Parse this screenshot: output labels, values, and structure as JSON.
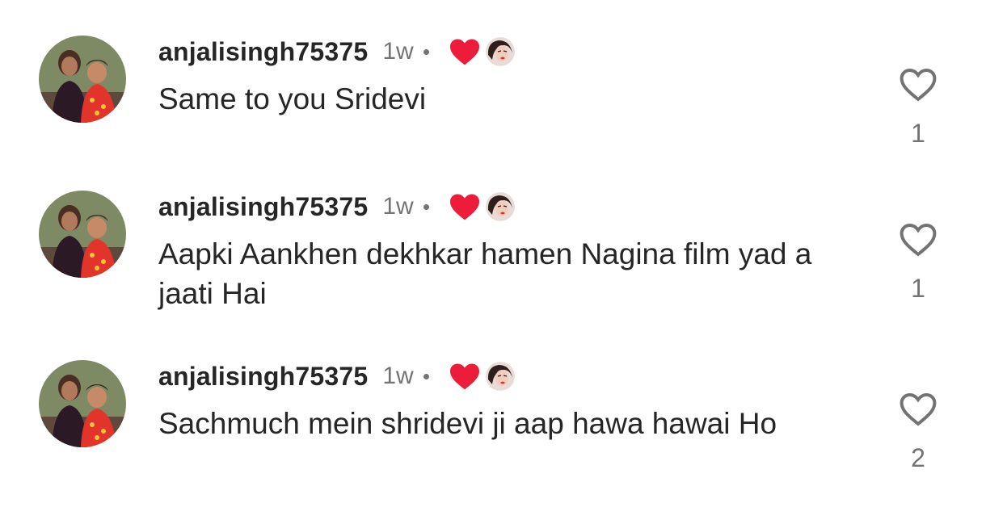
{
  "colors": {
    "text": "#262626",
    "secondary": "#737373",
    "creator_heart": "#ed1c3a",
    "background": "#ffffff"
  },
  "comments": [
    {
      "username": "anjalisingh75375",
      "time": "1w",
      "text": "Same to you Sridevi",
      "like_count": "1",
      "liked_by_creator": true,
      "avatar_icon": "user-avatar-photo",
      "like_icon": "heart-outline-icon"
    },
    {
      "username": "anjalisingh75375",
      "time": "1w",
      "text": "Aapki Aankhen dekhkar hamen Nagina film yad a jaati Hai",
      "like_count": "1",
      "liked_by_creator": true,
      "avatar_icon": "user-avatar-photo",
      "like_icon": "heart-outline-icon"
    },
    {
      "username": "anjalisingh75375",
      "time": "1w",
      "text": "Sachmuch mein shridevi ji aap hawa hawai Ho",
      "like_count": "2",
      "liked_by_creator": true,
      "avatar_icon": "user-avatar-photo",
      "like_icon": "heart-outline-icon"
    }
  ]
}
